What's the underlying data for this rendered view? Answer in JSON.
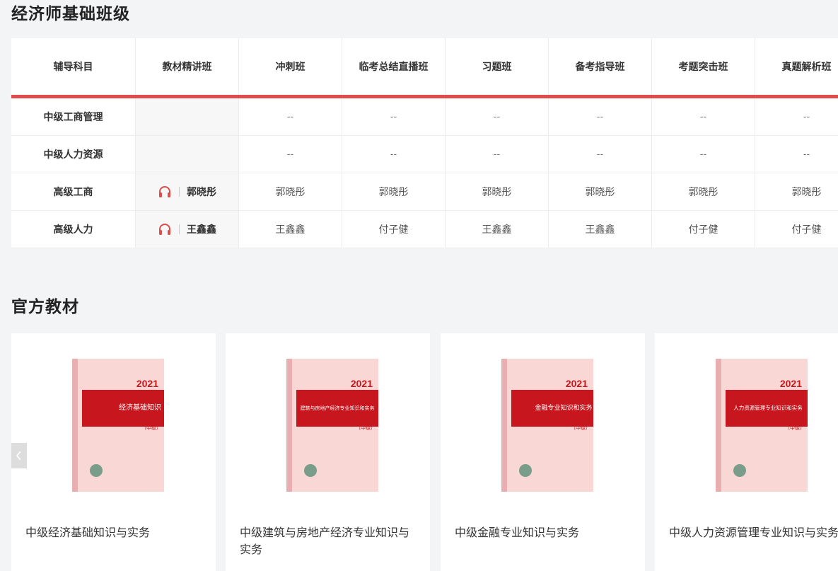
{
  "section1": {
    "title": "经济师基础班级"
  },
  "table": {
    "headers": [
      "辅导科目",
      "教材精讲班",
      "冲刺班",
      "临考总结直播班",
      "习题班",
      "备考指导班",
      "考题突击班",
      "真题解析班"
    ],
    "rows": [
      {
        "subject": "中级工商管理",
        "lecturer": "",
        "cells": [
          "--",
          "--",
          "--",
          "--",
          "--",
          "--"
        ]
      },
      {
        "subject": "中级人力资源",
        "lecturer": "",
        "cells": [
          "--",
          "--",
          "--",
          "--",
          "--",
          "--"
        ]
      },
      {
        "subject": "高级工商",
        "lecturer": "郭晓彤",
        "cells": [
          "郭晓彤",
          "郭晓彤",
          "郭晓彤",
          "郭晓彤",
          "郭晓彤",
          "郭晓彤"
        ]
      },
      {
        "subject": "高级人力",
        "lecturer": "王鑫鑫",
        "cells": [
          "王鑫鑫",
          "付子健",
          "王鑫鑫",
          "王鑫鑫",
          "付子健",
          "付子健"
        ]
      }
    ]
  },
  "section2": {
    "title": "官方教材"
  },
  "books": [
    {
      "title": "中级经济基础知识与实务",
      "cover_year": "2021",
      "cover_name": "经济基础知识",
      "cover_level": "（中级）"
    },
    {
      "title": "中级建筑与房地产经济专业知识与实务",
      "cover_year": "2021",
      "cover_name": "建筑与房地产经济专业知识和实务",
      "cover_level": "（中级）"
    },
    {
      "title": "中级金融专业知识与实务",
      "cover_year": "2021",
      "cover_name": "金融专业知识和实务",
      "cover_level": "（中级）"
    },
    {
      "title": "中级人力资源管理专业知识与实务",
      "cover_year": "2021",
      "cover_name": "人力资源管理专业知识和实务",
      "cover_level": "（中级）"
    }
  ],
  "colors": {
    "accent": "#e04b4b",
    "cover_red": "#c8161e",
    "cover_pink": "#f9d7d5"
  },
  "icons": {
    "lecturer": "headphones-icon",
    "carousel_prev": "chevron-left-icon"
  }
}
